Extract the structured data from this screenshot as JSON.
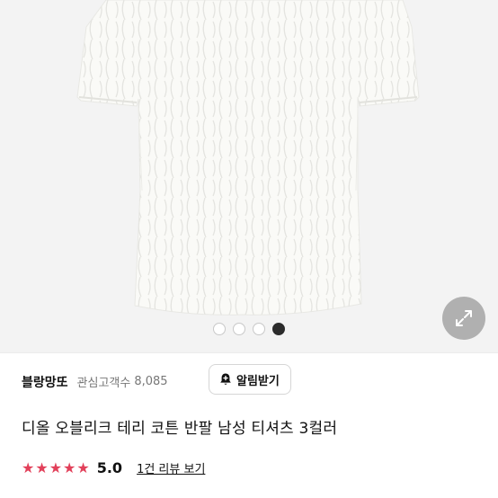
{
  "product_image": {
    "alt": "white terry t-shirt",
    "background": "#f3f3f3"
  },
  "carousel": {
    "count": 4,
    "active_index": 3
  },
  "seller": {
    "shop_name": "블랑망또",
    "favorites_label": "관심고객수",
    "favorites_count": "8,085",
    "notify_label": "알림받기"
  },
  "product": {
    "title": "디올 오블리크 테리 코튼 반팔 남성 티셔츠 3컬러"
  },
  "rating": {
    "stars": 5,
    "score": "5.0",
    "review_link": "1건 리뷰 보기",
    "star_color": "#e2405a"
  },
  "icons": {
    "expand": "expand-arrows-icon",
    "bell": "bell-plus-icon",
    "star": "star-icon"
  }
}
